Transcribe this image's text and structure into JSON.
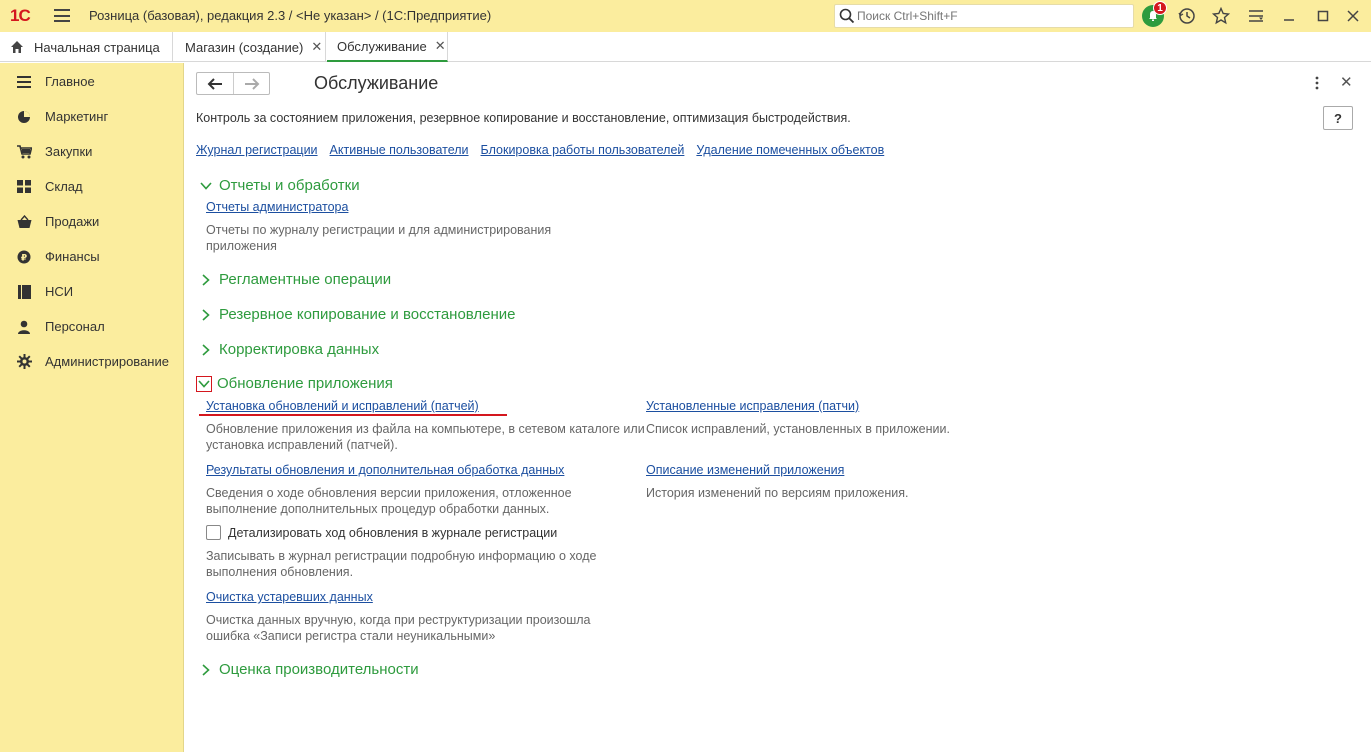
{
  "titlebar": {
    "logo": "1С",
    "title": "Розница (базовая), редакция 2.3 / <Не указан> /  (1С:Предприятие)",
    "search_placeholder": "Поиск Ctrl+Shift+F",
    "notification_count": "1"
  },
  "tabs": [
    {
      "label": "Начальная страница",
      "icon": "home-icon"
    },
    {
      "label": "Магазин (создание)",
      "closable": true
    },
    {
      "label": "Обслуживание",
      "closable": true,
      "active": true
    }
  ],
  "sidebar": {
    "items": [
      {
        "label": "Главное",
        "icon": "menu-lines-icon"
      },
      {
        "label": "Маркетинг",
        "icon": "pie-chart-icon"
      },
      {
        "label": "Закупки",
        "icon": "cart-icon"
      },
      {
        "label": "Склад",
        "icon": "grid-icon"
      },
      {
        "label": "Продажи",
        "icon": "basket-icon"
      },
      {
        "label": "Финансы",
        "icon": "ruble-coin-icon"
      },
      {
        "label": "НСИ",
        "icon": "book-icon"
      },
      {
        "label": "Персонал",
        "icon": "person-icon"
      },
      {
        "label": "Администрирование",
        "icon": "gear-icon"
      }
    ]
  },
  "main": {
    "title": "Обслуживание",
    "help_label": "?",
    "description": "Контроль за состоянием приложения, резервное копирование и восстановление, оптимизация быстродействия.",
    "top_links": [
      "Журнал регистрации",
      "Активные пользователи",
      "Блокировка работы пользователей",
      "Удаление помеченных объектов"
    ],
    "sections": {
      "reports": {
        "title": "Отчеты и обработки",
        "link": "Отчеты администратора",
        "note": "Отчеты по журналу регистрации и для администрирования приложения"
      },
      "routine": {
        "title": "Регламентные операции"
      },
      "backup": {
        "title": "Резервное копирование и восстановление"
      },
      "correction": {
        "title": "Корректировка данных"
      },
      "update": {
        "title": "Обновление приложения",
        "install_link": "Установка обновлений и исправлений (патчей)",
        "install_note": "Обновление приложения из файла на компьютере, в сетевом каталоге или установка исправлений (патчей).",
        "installed_link": "Установленные исправления (патчи)",
        "installed_note": "Список исправлений, установленных в приложении.",
        "results_link": "Результаты обновления и дополнительная обработка данных",
        "results_note": "Сведения о ходе обновления версии приложения, отложенное выполнение дополнительных процедур обработки данных.",
        "changes_link": "Описание изменений приложения",
        "changes_note": "История изменений по версиям приложения.",
        "detail_checkbox": "Детализировать ход обновления в журнале регистрации",
        "detail_note": "Записывать в журнал регистрации подробную информацию о ходе выполнения обновления.",
        "cleanup_link": "Очистка устаревших данных",
        "cleanup_note": "Очистка данных вручную, когда при реструктуризации произошла ошибка «Записи регистра стали неуникальными»"
      },
      "performance": {
        "title": "Оценка производительности"
      }
    }
  },
  "colors": {
    "accent_yellow": "#fbed9e",
    "green": "#2e9b3e",
    "link": "#1c4fa0",
    "red": "#d4171e"
  }
}
